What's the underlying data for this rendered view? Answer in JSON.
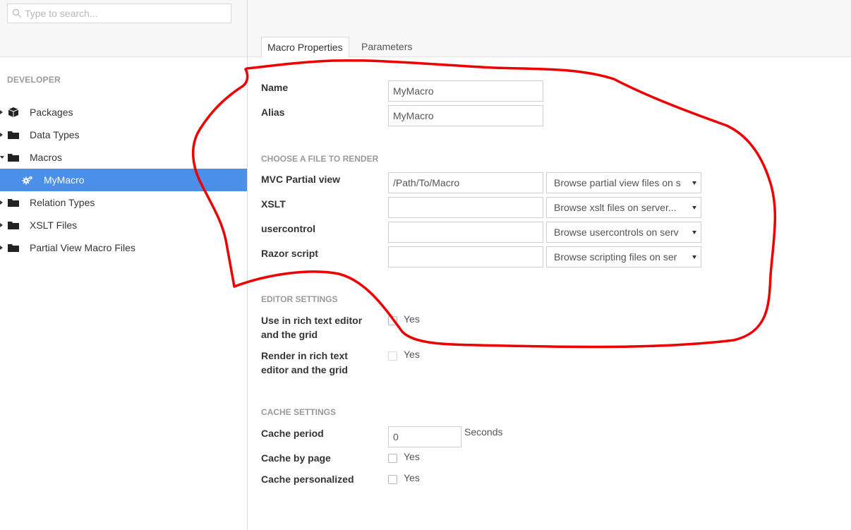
{
  "search": {
    "placeholder": "Type to search..."
  },
  "sidebar": {
    "section": "DEVELOPER",
    "items": [
      {
        "label": "Packages",
        "icon": "package-icon"
      },
      {
        "label": "Data Types",
        "icon": "folder-icon"
      },
      {
        "label": "Macros",
        "icon": "folder-icon"
      },
      {
        "label": "MyMacro",
        "icon": "gears-icon",
        "selected": true
      },
      {
        "label": "Relation Types",
        "icon": "folder-icon"
      },
      {
        "label": "XSLT Files",
        "icon": "folder-icon"
      },
      {
        "label": "Partial View Macro Files",
        "icon": "folder-icon"
      }
    ]
  },
  "tabs": [
    {
      "label": "Macro Properties",
      "active": true
    },
    {
      "label": "Parameters"
    }
  ],
  "form": {
    "name_label": "Name",
    "name_value": "MyMacro",
    "alias_label": "Alias",
    "alias_value": "MyMacro",
    "file_section": "CHOOSE A FILE TO RENDER",
    "mvc_label": "MVC Partial view",
    "mvc_value": "/Path/To/Macro",
    "mvc_select": "Browse partial view files on s",
    "xslt_label": "XSLT",
    "xslt_value": "",
    "xslt_select": "Browse xslt files on server...",
    "usercontrol_label": "usercontrol",
    "usercontrol_value": "",
    "usercontrol_select": "Browse usercontrols on serv",
    "razor_label": "Razor script",
    "razor_value": "",
    "razor_select": "Browse scripting files on ser",
    "editor_section": "EDITOR SETTINGS",
    "use_rte_label_1": "Use in rich text editor",
    "use_rte_label_2": "and the grid",
    "render_rte_label_1": "Render in rich text",
    "render_rte_label_2": "editor and the grid",
    "yes": "Yes",
    "cache_section": "CACHE SETTINGS",
    "cache_period_label": "Cache period",
    "cache_period_value": "0",
    "seconds": "Seconds",
    "cache_by_page_label": "Cache by page",
    "cache_personalized_label": "Cache personalized"
  },
  "colors": {
    "selected": "#4a8fea",
    "annotation": "#ee0000"
  }
}
